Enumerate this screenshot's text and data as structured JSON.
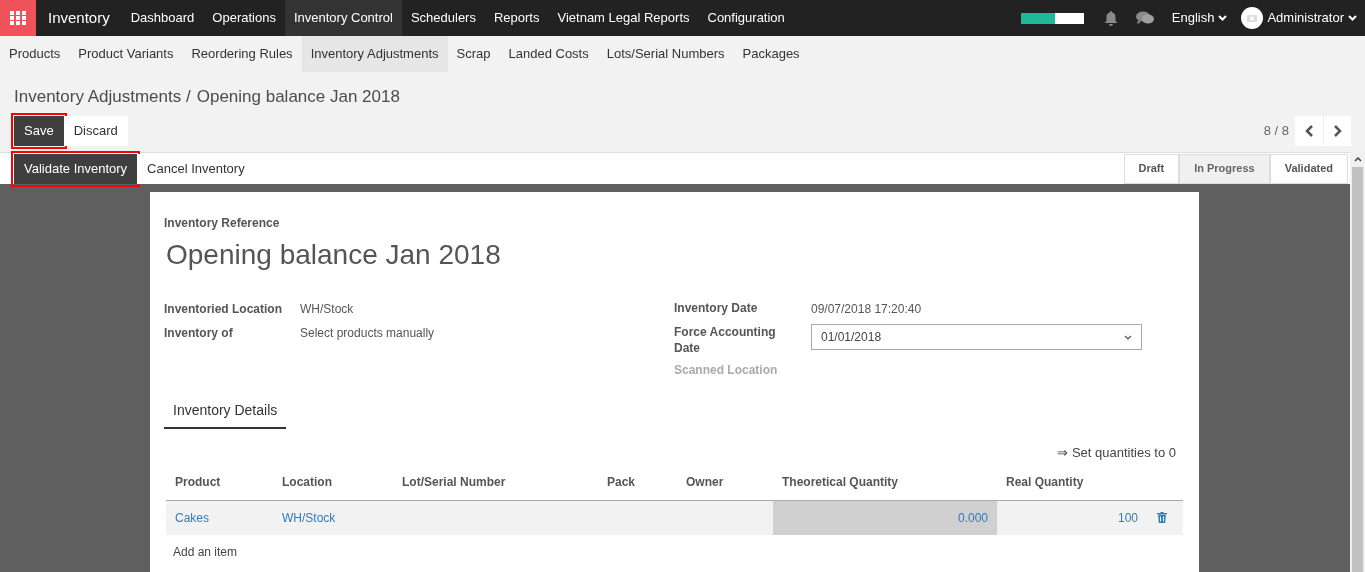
{
  "app_name": "Inventory",
  "main_menu": [
    {
      "label": "Dashboard",
      "selected": false
    },
    {
      "label": "Operations",
      "selected": false
    },
    {
      "label": "Inventory Control",
      "selected": true
    },
    {
      "label": "Schedulers",
      "selected": false
    },
    {
      "label": "Reports",
      "selected": false
    },
    {
      "label": "Vietnam Legal Reports",
      "selected": false
    },
    {
      "label": "Configuration",
      "selected": false
    }
  ],
  "systray": {
    "progress": {
      "level": 0.55
    },
    "language": "English",
    "user": "Administrator"
  },
  "sub_menu": [
    {
      "label": "Products",
      "selected": false
    },
    {
      "label": "Product Variants",
      "selected": false
    },
    {
      "label": "Reordering Rules",
      "selected": false
    },
    {
      "label": "Inventory Adjustments",
      "selected": true
    },
    {
      "label": "Scrap",
      "selected": false
    },
    {
      "label": "Landed Costs",
      "selected": false
    },
    {
      "label": "Lots/Serial Numbers",
      "selected": false
    },
    {
      "label": "Packages",
      "selected": false
    }
  ],
  "breadcrumb": [
    {
      "label": "Inventory Adjustments /"
    },
    {
      "label": "Opening balance Jan 2018"
    }
  ],
  "form_buttons": [
    {
      "label": "Save",
      "primary": true,
      "highlighted": true
    },
    {
      "label": "Discard",
      "primary": false,
      "highlighted": false
    }
  ],
  "pager": "8 / 8",
  "header_buttons": [
    {
      "label": "Validate Inventory",
      "primary": true,
      "highlighted": true
    },
    {
      "label": "Cancel Inventory",
      "primary": false,
      "highlighted": false
    }
  ],
  "stages": [
    {
      "label": "Draft",
      "selected": false
    },
    {
      "label": "In Progress",
      "selected": true
    },
    {
      "label": "Validated",
      "selected": false
    }
  ],
  "sheet": {
    "reference_label": "Inventory Reference",
    "title": "Opening balance Jan 2018",
    "left_fields": [
      {
        "label": "Inventoried Location",
        "value": "WH/Stock"
      },
      {
        "label": "Inventory of",
        "value": "Select products manually"
      }
    ],
    "right_fields": [
      {
        "kind": "text",
        "label": "Inventory Date",
        "value": "09/07/2018 17:20:40"
      },
      {
        "kind": "select",
        "label": "Force Accounting Date",
        "value": "01/01/2018"
      },
      {
        "kind": "muted",
        "label": "Scanned Location"
      }
    ],
    "tab": "Inventory Details",
    "set_quantities": "⇒ Set quantities to 0",
    "table": {
      "columns": [
        "Product",
        "Location",
        "Lot/Serial Number",
        "Pack",
        "Owner",
        "Theoretical Quantity",
        "Real Quantity"
      ],
      "rows": [
        {
          "product": "Cakes",
          "location": "WH/Stock",
          "theoretical": "0.000",
          "real": "100"
        }
      ],
      "add_item": "Add an item"
    }
  }
}
